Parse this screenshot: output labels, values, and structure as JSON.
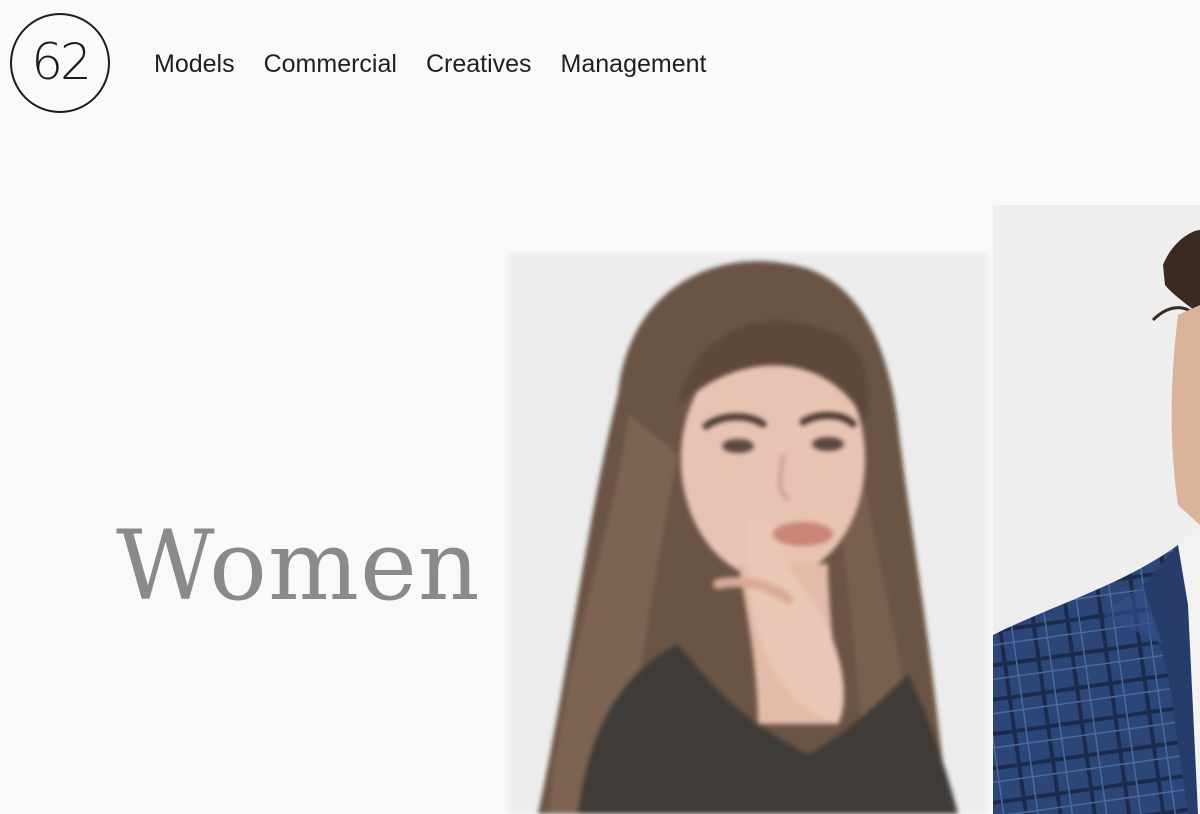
{
  "logo": {
    "text": "62"
  },
  "nav": {
    "items": [
      {
        "label": "Models"
      },
      {
        "label": "Commercial"
      },
      {
        "label": "Creatives"
      },
      {
        "label": "Management"
      }
    ]
  },
  "hero": {
    "title": "Women"
  },
  "colors": {
    "background": "#f9f9f9",
    "nav_text": "#1f1f1f",
    "hero_text": "#8a8a8a",
    "jacket": "#2e4777"
  }
}
